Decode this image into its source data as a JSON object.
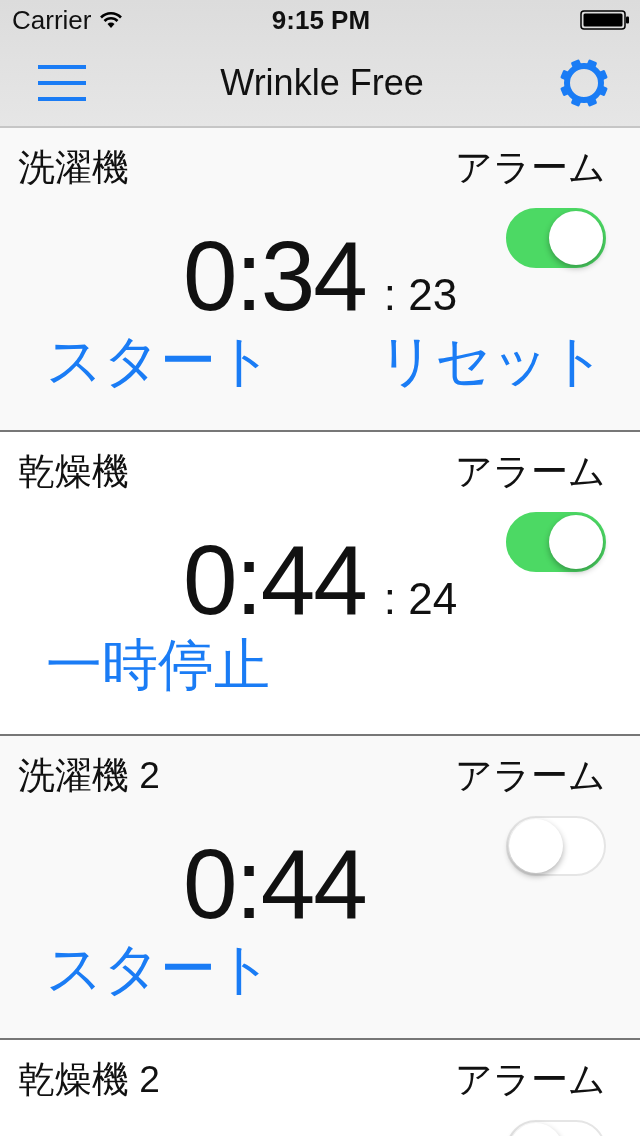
{
  "status_bar": {
    "carrier": "Carrier",
    "time": "9:15 PM"
  },
  "nav": {
    "title": "Wrinkle Free"
  },
  "timers": [
    {
      "name": "洗濯機",
      "alarm_label": "アラーム",
      "alarm_on": true,
      "time": "0:34",
      "seconds": ": 23",
      "buttons": [
        "スタート",
        "リセット"
      ]
    },
    {
      "name": "乾燥機",
      "alarm_label": "アラーム",
      "alarm_on": true,
      "time": "0:44",
      "seconds": ": 24",
      "buttons": [
        "一時停止"
      ]
    },
    {
      "name": "洗濯機 2",
      "alarm_label": "アラーム",
      "alarm_on": false,
      "time": "0:44",
      "buttons": [
        "スタート"
      ]
    },
    {
      "name": "乾燥機 2",
      "alarm_label": "アラーム",
      "alarm_on": false
    }
  ]
}
